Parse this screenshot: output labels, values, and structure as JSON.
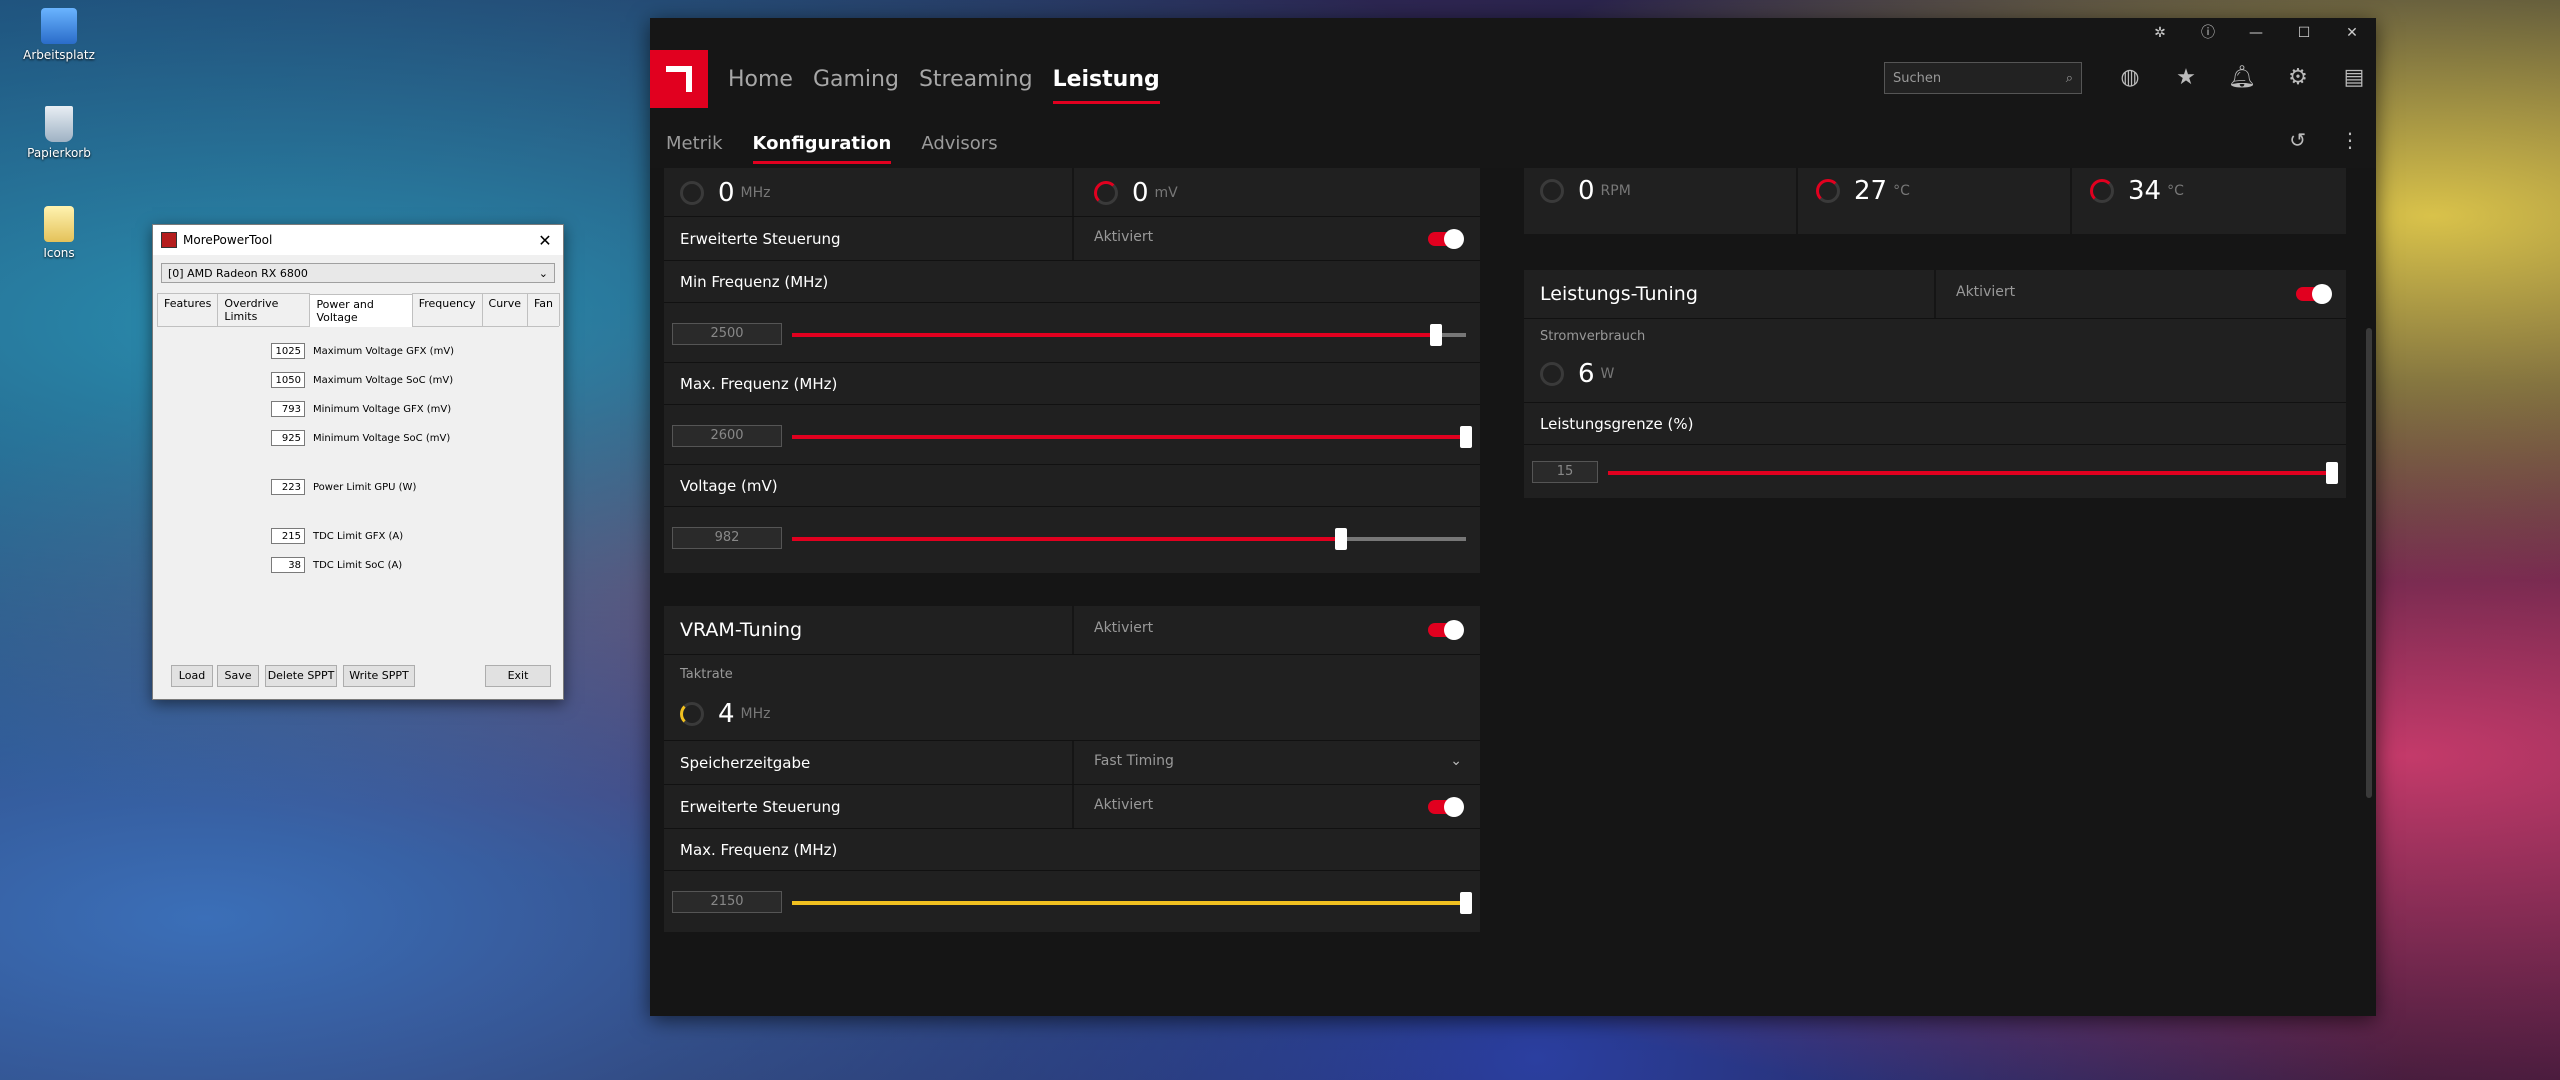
{
  "desktop": {
    "icons": [
      {
        "label": "Arbeitsplatz",
        "icon": "computer-icon"
      },
      {
        "label": "Papierkorb",
        "icon": "recycle-bin-icon"
      },
      {
        "label": "Icons",
        "icon": "folder-icon"
      }
    ]
  },
  "mpt": {
    "title": "MorePowerTool",
    "gpu_select": "[0] AMD Radeon RX 6800",
    "tabs": [
      "Features",
      "Overdrive Limits",
      "Power and Voltage",
      "Frequency",
      "Curve",
      "Fan"
    ],
    "active_tab": "Power and Voltage",
    "fields": [
      {
        "value": "1025",
        "label": "Maximum Voltage GFX (mV)"
      },
      {
        "value": "1050",
        "label": "Maximum Voltage SoC (mV)"
      },
      {
        "value": "793",
        "label": "Minimum Voltage GFX (mV)"
      },
      {
        "value": "925",
        "label": "Minimum Voltage SoC (mV)"
      },
      {
        "value": "223",
        "label": "Power Limit GPU (W)"
      },
      {
        "value": "215",
        "label": "TDC Limit GFX (A)"
      },
      {
        "value": "38",
        "label": "TDC Limit SoC (A)"
      }
    ],
    "buttons": {
      "load": "Load",
      "save": "Save",
      "delete": "Delete SPPT",
      "write": "Write SPPT",
      "exit": "Exit"
    }
  },
  "amd": {
    "nav": {
      "home": "Home",
      "gaming": "Gaming",
      "streaming": "Streaming",
      "leistung": "Leistung"
    },
    "search_placeholder": "Suchen",
    "subnav": {
      "metrik": "Metrik",
      "konfiguration": "Konfiguration",
      "advisors": "Advisors"
    },
    "gpu_panel": {
      "clock_value": "0",
      "clock_unit": "MHz",
      "voltage_value": "0",
      "voltage_unit": "mV",
      "erweiterte_label": "Erweiterte Steuerung",
      "erweiterte_status": "Aktiviert",
      "min_freq_label": "Min Frequenz (MHz)",
      "min_freq_value": "2500",
      "min_freq_fraction": 0.955,
      "max_freq_label": "Max. Frequenz (MHz)",
      "max_freq_value": "2600",
      "max_freq_fraction": 1.0,
      "voltage_label": "Voltage (mV)",
      "voltage_slider_value": "982",
      "voltage_fraction": 0.815
    },
    "vram_panel": {
      "title": "VRAM-Tuning",
      "status": "Aktiviert",
      "clock_label": "Taktrate",
      "clock_value": "4",
      "clock_unit": "MHz",
      "timing_label": "Speicherzeitgabe",
      "timing_value": "Fast Timing",
      "erweiterte_label": "Erweiterte Steuerung",
      "erweiterte_status": "Aktiviert",
      "max_freq_label": "Max. Frequenz (MHz)",
      "max_freq_value": "2150",
      "max_freq_fraction": 1.0
    },
    "fan_panel": {
      "rpm_value": "0",
      "rpm_unit": "RPM",
      "temp1_value": "27",
      "temp1_unit": "°C",
      "temp2_value": "34",
      "temp2_unit": "°C"
    },
    "power_panel": {
      "title": "Leistungs-Tuning",
      "status": "Aktiviert",
      "consumption_label": "Stromverbrauch",
      "consumption_value": "6",
      "consumption_unit": "W",
      "limit_label": "Leistungsgrenze (%)",
      "limit_value": "15",
      "limit_fraction": 1.0
    },
    "colors": {
      "accent": "#e1001f",
      "vram_accent": "#f0c020",
      "panel": "#202020"
    }
  }
}
